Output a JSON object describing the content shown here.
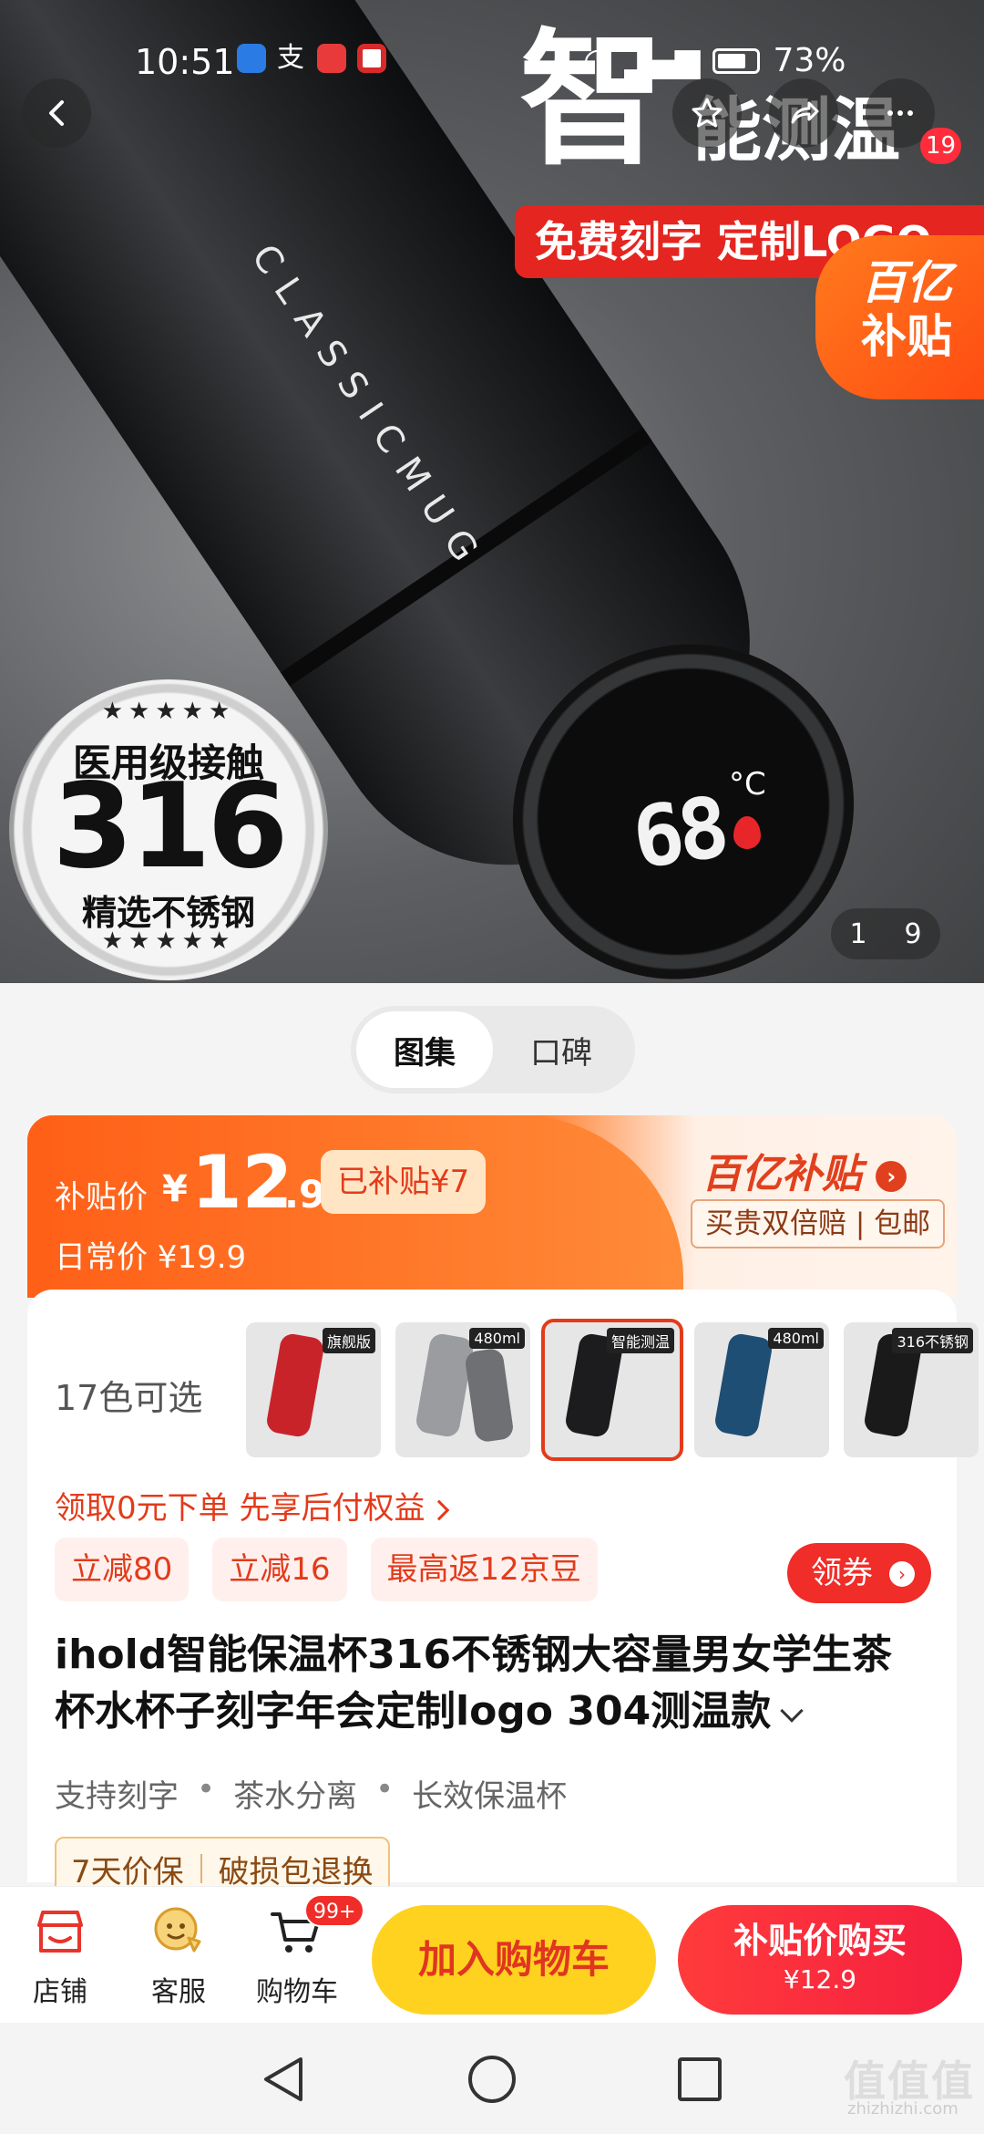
{
  "status": {
    "time": "10:51",
    "battery": "73%"
  },
  "hero": {
    "heading_big": "智",
    "heading_rest": "能测温",
    "banner": "免费刻字 定制LOGO",
    "bottle_text": "CLASSICMUG",
    "temperature": "68",
    "temperature_unit": "°C",
    "subsidy_badge_line1": "百亿",
    "subsidy_badge_line2": "补贴",
    "seal_top": "医用级接触",
    "seal_number": "316",
    "seal_bottom": "精选不锈钢",
    "image_index": "1",
    "image_total": "9"
  },
  "nav": {
    "message_count": "19"
  },
  "gallery_tabs": [
    {
      "label": "图集",
      "active": true
    },
    {
      "label": "口碑",
      "active": false
    }
  ],
  "price": {
    "label": "补贴价",
    "currency": "¥",
    "integer": "12",
    "decimal": ".9",
    "saved": "已补贴¥7",
    "daily": "日常价 ¥19.9",
    "brand": "百亿补贴",
    "guarantee": "买贵双倍赔 | 包邮"
  },
  "product": {
    "colors_label": "17色可选",
    "thumbnails": [
      {
        "color": "#c9232a",
        "tag": "旗舰版"
      },
      {
        "color": "#9a9c9f",
        "tag": "480ml"
      },
      {
        "color": "#1c1c1e",
        "tag": "智能测温"
      },
      {
        "color": "#1f4e74",
        "tag": "480ml"
      },
      {
        "color": "#1a1a1a",
        "tag": "316不锈钢"
      }
    ],
    "bnpl": "领取0元下单 先享后付权益",
    "chips": [
      "立减80",
      "立减16",
      "最高返12京豆"
    ],
    "coupon_button": "领券",
    "title": "ihold智能保温杯316不锈钢大容量男女学生茶杯水杯子刻字年会定制logo 304测温款",
    "features": [
      "支持刻字",
      "茶水分离",
      "长效保温杯"
    ],
    "guarantees": [
      "7天价保",
      "破损包退换"
    ]
  },
  "bottom_bar": {
    "store": "店铺",
    "service": "客服",
    "cart": "购物车",
    "cart_badge": "99+",
    "add_to_cart": "加入购物车",
    "buy_now": "补贴价购买",
    "buy_price": "¥12.9"
  },
  "watermark": {
    "main": "值值值",
    "sub": "zhizhizhi.com"
  },
  "colors": {
    "accent_red": "#f02d28",
    "accent_orange": "#ff6a1f",
    "cart_yellow": "#ffd21f"
  }
}
